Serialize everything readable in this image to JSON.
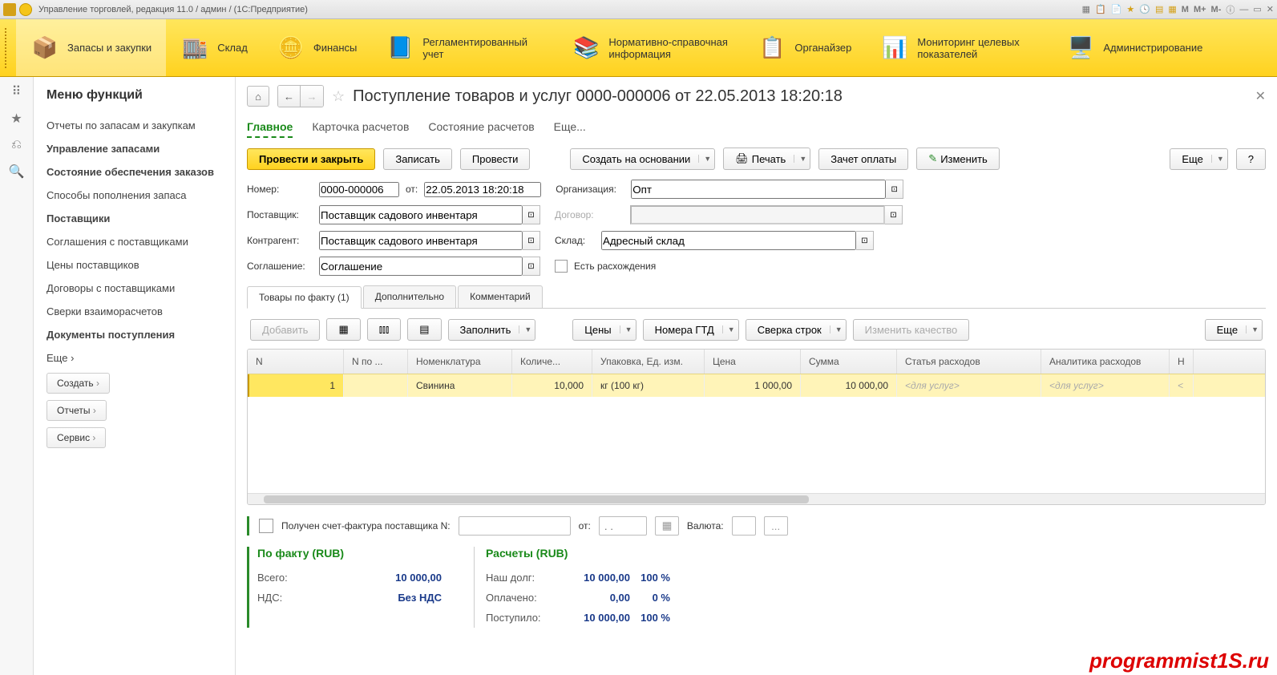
{
  "titlebar": {
    "text": "Управление торговлей, редакция 11.0 / админ /   (1С:Предприятие)",
    "m": "М",
    "mplus": "М+",
    "mminus": "М-"
  },
  "mainnav": [
    {
      "label": "Запасы и закупки",
      "active": true
    },
    {
      "label": "Склад"
    },
    {
      "label": "Финансы"
    },
    {
      "label": "Регламентированный учет"
    },
    {
      "label": "Нормативно-справочная информация"
    },
    {
      "label": "Органайзер"
    },
    {
      "label": "Мониторинг целевых показателей"
    },
    {
      "label": "Администрирование"
    }
  ],
  "sidebar": {
    "title": "Меню функций",
    "items": [
      {
        "label": "Отчеты по запасам и закупкам"
      },
      {
        "label": "Управление запасами",
        "bold": true
      },
      {
        "label": "Состояние обеспечения заказов",
        "bold": true
      },
      {
        "label": "Способы пополнения запаса"
      },
      {
        "label": "Поставщики",
        "bold": true
      },
      {
        "label": "Соглашения с поставщиками"
      },
      {
        "label": "Цены поставщиков"
      },
      {
        "label": "Договоры с поставщиками"
      },
      {
        "label": "Сверки взаиморасчетов"
      },
      {
        "label": "Документы поступления",
        "bold": true
      },
      {
        "label": "Еще ›"
      }
    ],
    "btns": {
      "create": "Создать",
      "reports": "Отчеты",
      "service": "Сервис"
    }
  },
  "doc": {
    "title": "Поступление товаров и услуг 0000-000006 от 22.05.2013 18:20:18",
    "tabs": {
      "main": "Главное",
      "card": "Карточка расчетов",
      "state": "Состояние расчетов",
      "more": "Еще..."
    },
    "toolbar": {
      "post_close": "Провести и закрыть",
      "save": "Записать",
      "post": "Провести",
      "create_based": "Создать на основании",
      "print": "Печать",
      "offset": "Зачет оплаты",
      "edit": "Изменить",
      "more": "Еще",
      "help": "?"
    },
    "fields": {
      "number_lbl": "Номер:",
      "number": "0000-000006",
      "from_lbl": "от:",
      "from": "22.05.2013 18:20:18",
      "org_lbl": "Организация:",
      "org": "Опт",
      "supplier_lbl": "Поставщик:",
      "supplier": "Поставщик садового инвентаря",
      "contract_lbl": "Договор:",
      "contract": "",
      "counter_lbl": "Контрагент:",
      "counter": "Поставщик садового инвентаря",
      "warehouse_lbl": "Склад:",
      "warehouse": "Адресный склад",
      "agreement_lbl": "Соглашение:",
      "agreement": "Соглашение",
      "discrepancy_lbl": "Есть расхождения"
    },
    "inner_tabs": {
      "goods": "Товары по факту (1)",
      "extra": "Дополнительно",
      "comment": "Комментарий"
    },
    "table_toolbar": {
      "add": "Добавить",
      "fill": "Заполнить",
      "prices": "Цены",
      "gtd": "Номера ГТД",
      "reconcile": "Сверка строк",
      "quality": "Изменить качество",
      "more": "Еще"
    },
    "columns": {
      "n": "N",
      "npo": "N по ...",
      "nomen": "Номенклатура",
      "qty": "Количе...",
      "pack": "Упаковка, Ед. изм.",
      "price": "Цена",
      "sum": "Сумма",
      "art": "Статья расходов",
      "analytics": "Аналитика расходов",
      "h": "Н"
    },
    "row": {
      "n": "1",
      "npo": "",
      "nomen": "Свинина",
      "qty": "10,000",
      "pack": "кг (100 кг)",
      "price": "1 000,00",
      "sum": "10 000,00",
      "art": "<для услуг>",
      "analytics": "<для услуг>",
      "h": "<"
    },
    "invoice": {
      "label": "Получен счет-фактура поставщика N:",
      "from": "от:",
      "date_placeholder": ". .",
      "currency": "Валюта:"
    },
    "totals_fact": {
      "title": "По факту (RUB)",
      "total_lbl": "Всего:",
      "total": "10 000,00",
      "vat_lbl": "НДС:",
      "vat": "Без НДС"
    },
    "totals_calc": {
      "title": "Расчеты (RUB)",
      "debt_lbl": "Наш долг:",
      "debt": "10 000,00",
      "debt_pct": "100 %",
      "paid_lbl": "Оплачено:",
      "paid": "0,00",
      "paid_pct": "0 %",
      "recv_lbl": "Поступило:",
      "recv": "10 000,00",
      "recv_pct": "100 %"
    }
  },
  "watermark": "programmist1S.ru"
}
